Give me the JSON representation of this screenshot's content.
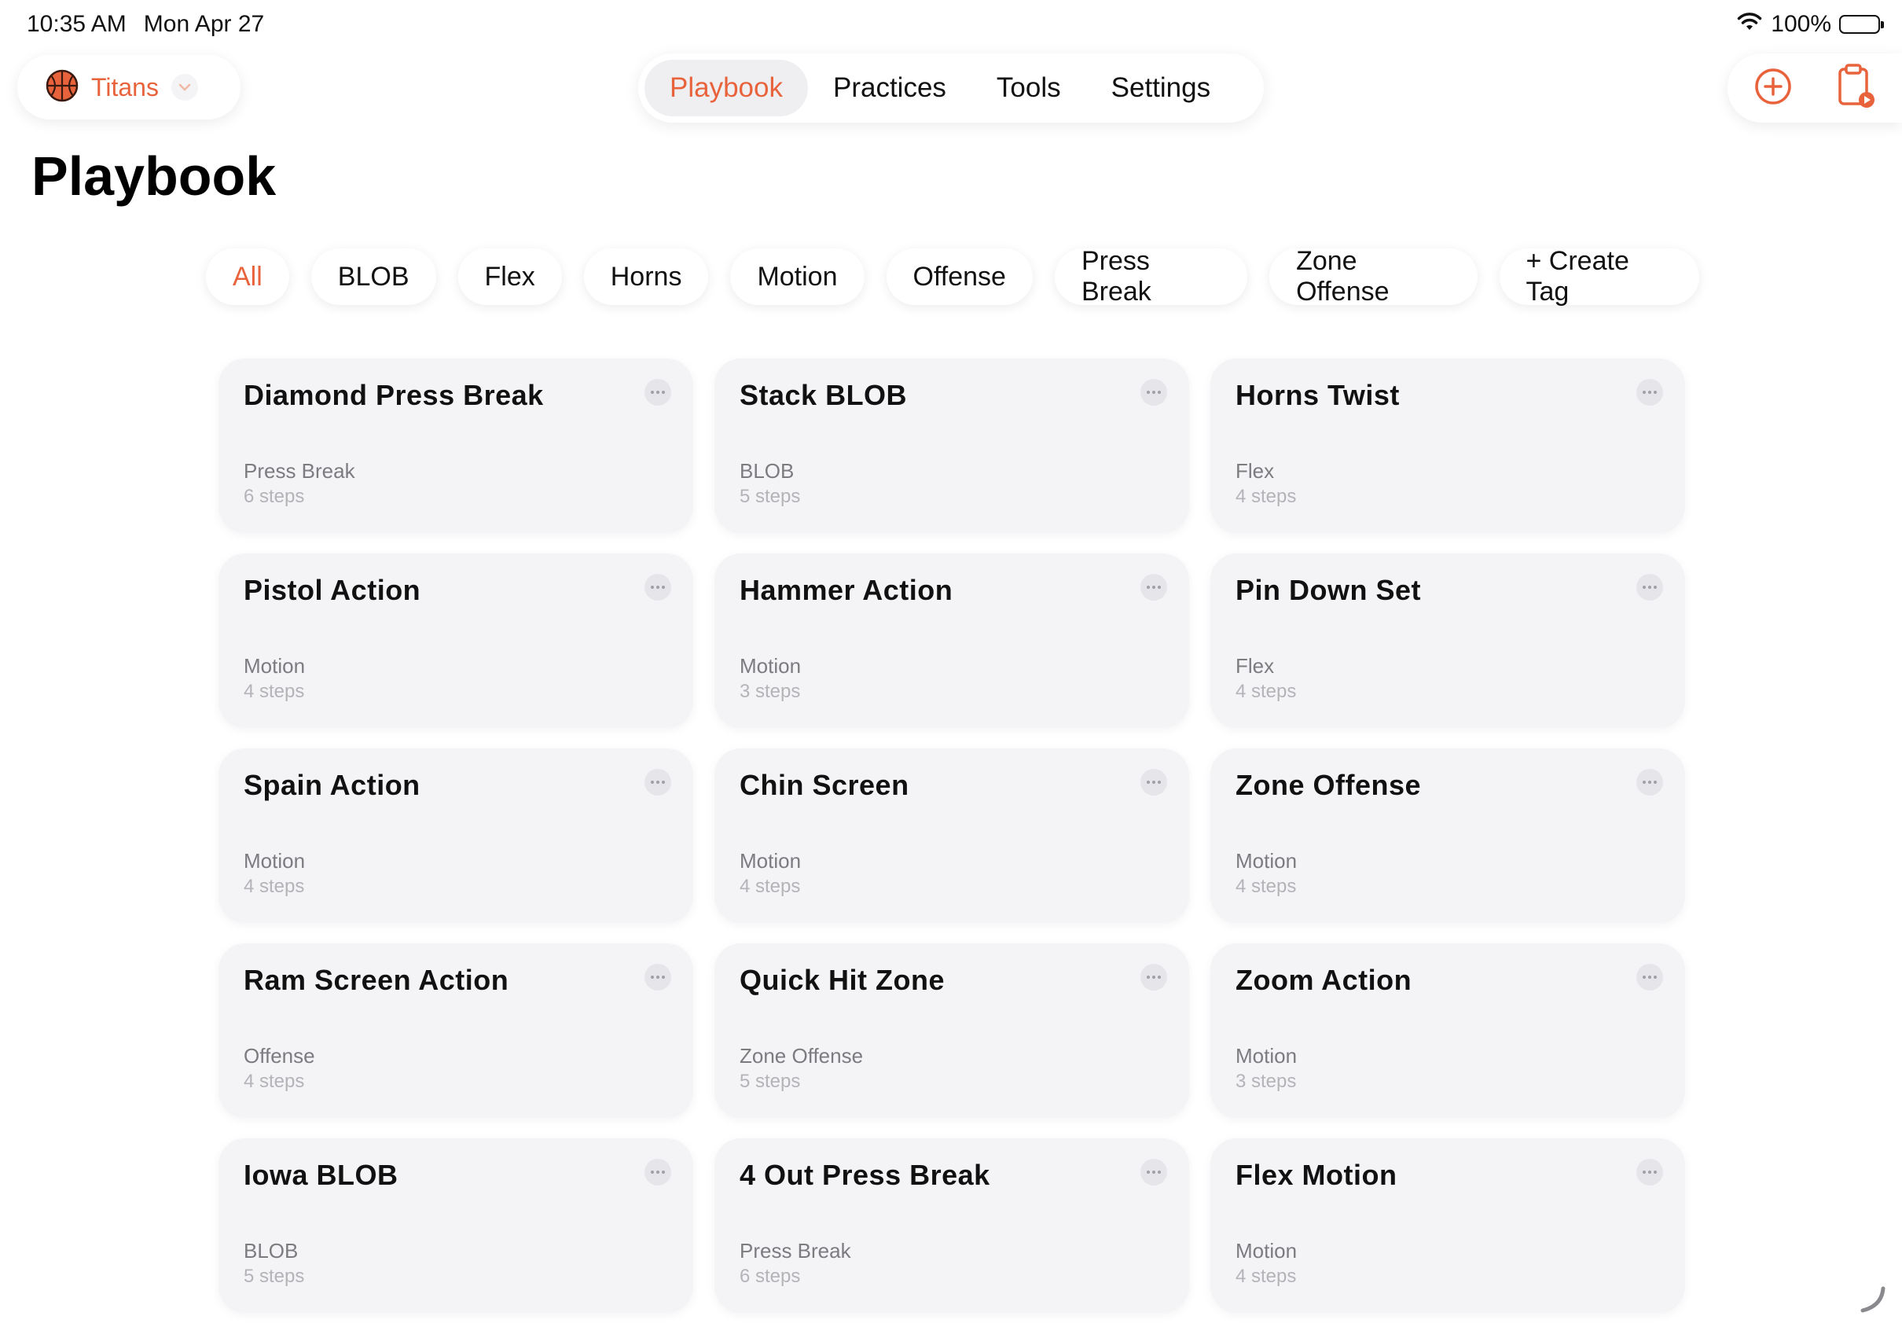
{
  "status": {
    "time": "10:35 AM",
    "date": "Mon Apr 27",
    "battery": "100%"
  },
  "team": {
    "name": "Titans",
    "icon": "basketball-icon"
  },
  "nav": {
    "tabs": [
      {
        "label": "Playbook",
        "active": true
      },
      {
        "label": "Practices",
        "active": false
      },
      {
        "label": "Tools",
        "active": false
      },
      {
        "label": "Settings",
        "active": false
      }
    ]
  },
  "actions": {
    "add_icon": "plus-circle-icon",
    "clipboard_icon": "clipboard-play-icon"
  },
  "page": {
    "title": "Playbook"
  },
  "filters": [
    {
      "label": "All",
      "active": true
    },
    {
      "label": "BLOB",
      "active": false
    },
    {
      "label": "Flex",
      "active": false
    },
    {
      "label": "Horns",
      "active": false
    },
    {
      "label": "Motion",
      "active": false
    },
    {
      "label": "Offense",
      "active": false
    },
    {
      "label": "Press Break",
      "active": false
    },
    {
      "label": "Zone Offense",
      "active": false
    },
    {
      "label": "+ Create Tag",
      "active": false
    }
  ],
  "plays": [
    {
      "title": "Diamond Press Break",
      "tag": "Press Break",
      "steps": "6 steps"
    },
    {
      "title": "Stack BLOB",
      "tag": "BLOB",
      "steps": "5 steps"
    },
    {
      "title": "Horns Twist",
      "tag": "Flex",
      "steps": "4 steps"
    },
    {
      "title": "Pistol Action",
      "tag": "Motion",
      "steps": "4 steps"
    },
    {
      "title": "Hammer Action",
      "tag": "Motion",
      "steps": "3 steps"
    },
    {
      "title": "Pin Down Set",
      "tag": "Flex",
      "steps": "4 steps"
    },
    {
      "title": "Spain Action",
      "tag": "Motion",
      "steps": "4 steps"
    },
    {
      "title": "Chin Screen",
      "tag": "Motion",
      "steps": "4 steps"
    },
    {
      "title": "Zone Offense",
      "tag": "Motion",
      "steps": "4 steps"
    },
    {
      "title": "Ram Screen Action",
      "tag": "Offense",
      "steps": "4 steps"
    },
    {
      "title": "Quick Hit Zone",
      "tag": "Zone Offense",
      "steps": "5 steps"
    },
    {
      "title": "Zoom Action",
      "tag": "Motion",
      "steps": "3 steps"
    },
    {
      "title": "Iowa BLOB",
      "tag": "BLOB",
      "steps": "5 steps"
    },
    {
      "title": "4 Out Press Break",
      "tag": "Press Break",
      "steps": "6 steps"
    },
    {
      "title": "Flex Motion",
      "tag": "Motion",
      "steps": "4 steps"
    }
  ],
  "colors": {
    "accent": "#e8633c",
    "card_bg": "#f4f4f7",
    "secondary_text": "#7c7c80",
    "tertiary_text": "#b4b4b8"
  }
}
